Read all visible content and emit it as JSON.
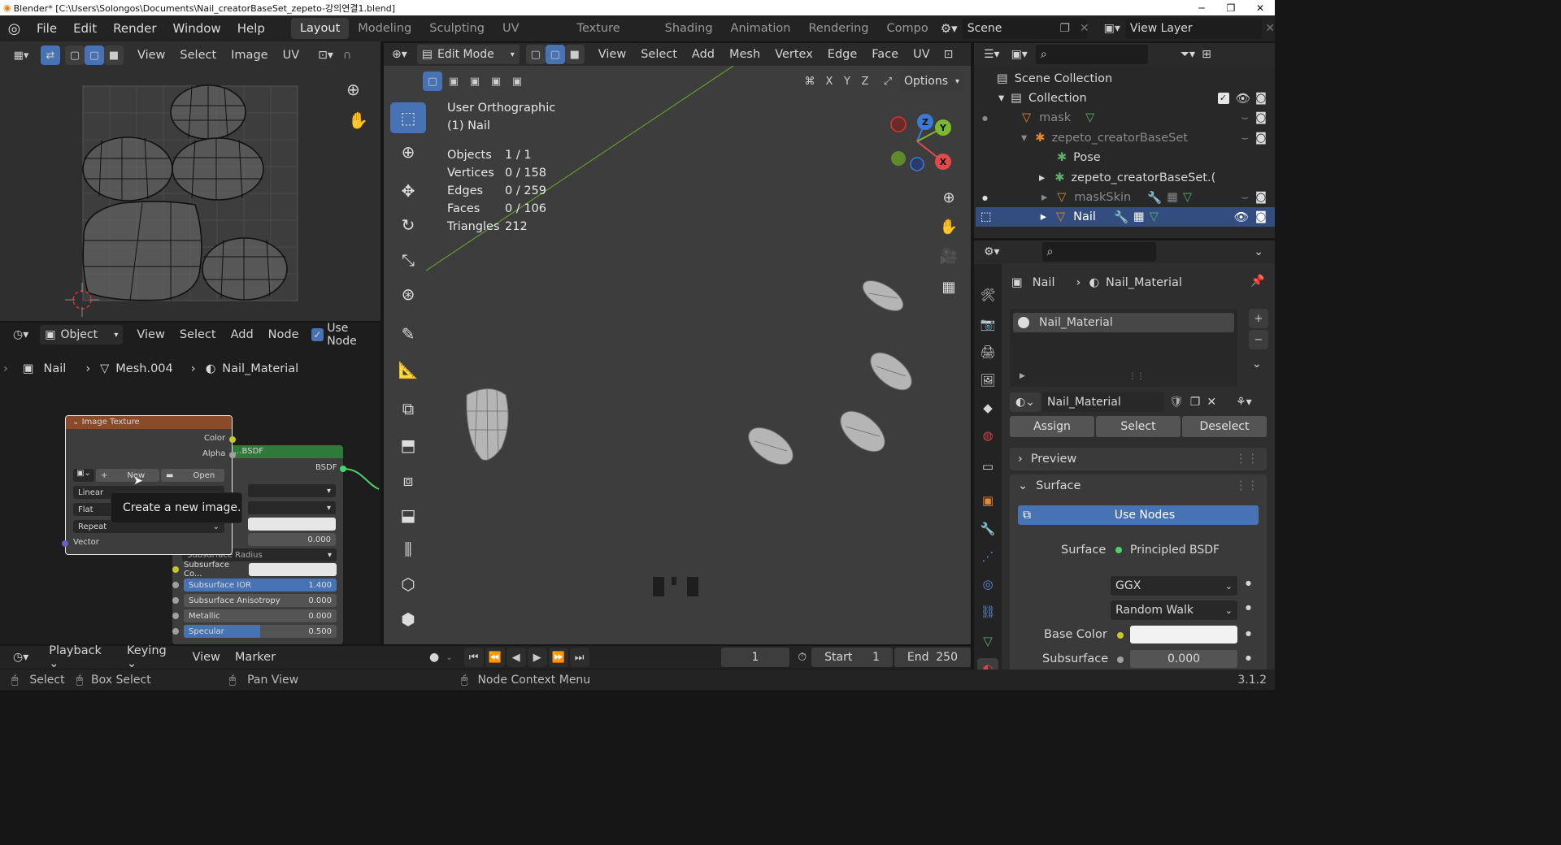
{
  "window": {
    "title": "Blender* [C:\\Users\\Solongos\\Documents\\Nail_creatorBaseSet_zepeto-강의연결1.blend]"
  },
  "menu": [
    "File",
    "Edit",
    "Render",
    "Window",
    "Help"
  ],
  "workspaces": [
    "Layout",
    "Modeling",
    "Sculpting",
    "UV Editing",
    "Texture Paint",
    "Shading",
    "Animation",
    "Rendering",
    "Compo"
  ],
  "scene": {
    "name": "Scene",
    "view_layer": "View Layer"
  },
  "uv_editor": {
    "menus": [
      "View",
      "Select",
      "Image",
      "UV"
    ]
  },
  "viewport": {
    "mode": "Edit Mode",
    "menus": [
      "View",
      "Select",
      "Add",
      "Mesh",
      "Vertex",
      "Edge",
      "Face",
      "UV"
    ],
    "options": "Options",
    "axes": [
      "X",
      "Y",
      "Z"
    ],
    "view_name": "User Orthographic",
    "object_name": "(1) Nail",
    "stats": [
      {
        "label": "Objects",
        "value": "1 / 1"
      },
      {
        "label": "Vertices",
        "value": "0 / 158"
      },
      {
        "label": "Edges",
        "value": "0 / 259"
      },
      {
        "label": "Faces",
        "value": "0 / 106"
      },
      {
        "label": "Triangles",
        "value": "212"
      }
    ],
    "gizmo": {
      "z": "Z",
      "y": "Y",
      "x": "X"
    }
  },
  "node_editor": {
    "mode": "Object",
    "menus": [
      "View",
      "Select",
      "Add",
      "Node"
    ],
    "use_nodes": "Use Node",
    "breadcrumb": [
      "Nail",
      "Mesh.004",
      "Nail_Material"
    ],
    "image_texture": {
      "title": "Image Texture",
      "out_color": "Color",
      "out_alpha": "Alpha",
      "new": "New",
      "open": "Open",
      "interp": "Linear",
      "proj": "Flat",
      "ext": "Repeat",
      "vector": "Vector"
    },
    "tooltip": "Create a new image.",
    "bsdf": {
      "title": "...BSDF",
      "out": "BSDF",
      "rows": [
        {
          "label": "",
          "value": "0.000"
        },
        {
          "label": "Subsurface Radius",
          "value": ""
        },
        {
          "label": "Subsurface Co...",
          "value": ""
        },
        {
          "label": "Subsurface IOR",
          "value": "1.400"
        },
        {
          "label": "Subsurface Anisotropy",
          "value": "0.000"
        },
        {
          "label": "Metallic",
          "value": "0.000"
        },
        {
          "label": "Specular",
          "value": "0.500"
        }
      ]
    }
  },
  "timeline": {
    "menus": [
      "Playback",
      "Keying",
      "View",
      "Marker"
    ],
    "frame": "1",
    "start_label": "Start",
    "start": "1",
    "end_label": "End",
    "end": "250"
  },
  "outliner": {
    "rows": [
      "Scene Collection",
      "Collection",
      "mask",
      "zepeto_creatorBaseSet",
      "Pose",
      "zepeto_creatorBaseSet.(",
      "maskSkin",
      "Nail"
    ]
  },
  "properties": {
    "breadcrumb": [
      "Nail",
      "Nail_Material"
    ],
    "slot": "Nail_Material",
    "material": "Nail_Material",
    "assign": "Assign",
    "select": "Select",
    "deselect": "Deselect",
    "preview": "Preview",
    "surface": "Surface",
    "use_nodes": "Use Nodes",
    "surface_label": "Surface",
    "surface_value": "Principled BSDF",
    "distribution": "GGX",
    "subsurface_method": "Random Walk",
    "base_color_label": "Base Color",
    "subsurface_label": "Subsurface",
    "subsurface_value": "0.000"
  },
  "statusbar": {
    "select": "Select",
    "box_select": "Box Select",
    "pan_view": "Pan View",
    "node_context": "Node Context Menu",
    "version": "3.1.2"
  },
  "colors": {
    "accent": "#4772b3",
    "header": "#2a2a2a",
    "node_header_texture": "#8a4b2a",
    "node_header_shader": "#2d7a3a"
  }
}
